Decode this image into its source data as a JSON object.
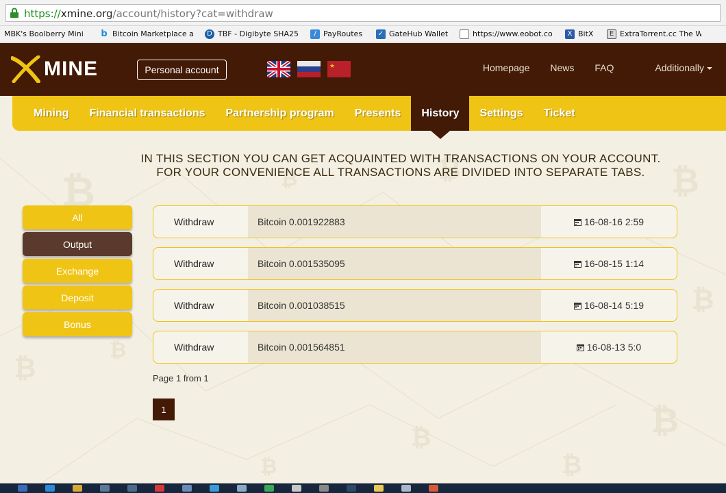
{
  "browser": {
    "url_scheme": "https://",
    "url_host": "xmine.org",
    "url_path": "/account/history?cat=withdraw",
    "bookmarks": [
      {
        "label": "MBK's Boolberry Mini",
        "icon": "page-icon"
      },
      {
        "label": "Bitcoin Marketplace a",
        "icon": "b-icon"
      },
      {
        "label": "TBF - Digibyte SHA25(",
        "icon": "digibyte-icon"
      },
      {
        "label": "PayRoutes",
        "icon": "payroutes-icon"
      },
      {
        "label": "GateHub Wallet",
        "icon": "gatehub-icon"
      },
      {
        "label": "https://www.eobot.co",
        "icon": "page-icon"
      },
      {
        "label": "BitX",
        "icon": "bitx-icon"
      },
      {
        "label": "ExtraTorrent.cc The W",
        "icon": "extratorrent-icon"
      }
    ]
  },
  "header": {
    "logo_text": "MINE",
    "personal_account": "Personal account",
    "flags": [
      "uk-flag",
      "russia-flag",
      "china-flag"
    ],
    "nav": [
      "Homepage",
      "News",
      "FAQ",
      "Additionally"
    ]
  },
  "menu": {
    "items": [
      "Mining",
      "Financial transactions",
      "Partnership program",
      "Presents",
      "History",
      "Settings",
      "Ticket"
    ],
    "active": "History"
  },
  "intro": {
    "line1": "IN THIS SECTION YOU CAN GET ACQUAINTED WITH TRANSACTIONS ON YOUR ACCOUNT.",
    "line2": "FOR YOUR CONVENIENCE ALL TRANSACTIONS ARE DIVIDED INTO SEPARATE TABS."
  },
  "tabs": {
    "items": [
      "All",
      "Output",
      "Exchange",
      "Deposit",
      "Bonus"
    ],
    "active": "Output"
  },
  "transactions": [
    {
      "type": "Withdraw",
      "amount": "Bitcoin 0.001922883",
      "date": "16-08-16 2:59"
    },
    {
      "type": "Withdraw",
      "amount": "Bitcoin 0.001535095",
      "date": "16-08-15 1:14"
    },
    {
      "type": "Withdraw",
      "amount": "Bitcoin 0.001038515",
      "date": "16-08-14 5:19"
    },
    {
      "type": "Withdraw",
      "amount": "Bitcoin 0.001564851",
      "date": "16-08-13 5:0"
    }
  ],
  "pagination": {
    "info": "Page 1 from 1",
    "current": "1"
  },
  "colors": {
    "brand_dark": "#421a05",
    "brand_yellow": "#f0c414",
    "active_tab": "#5a3a2c"
  }
}
